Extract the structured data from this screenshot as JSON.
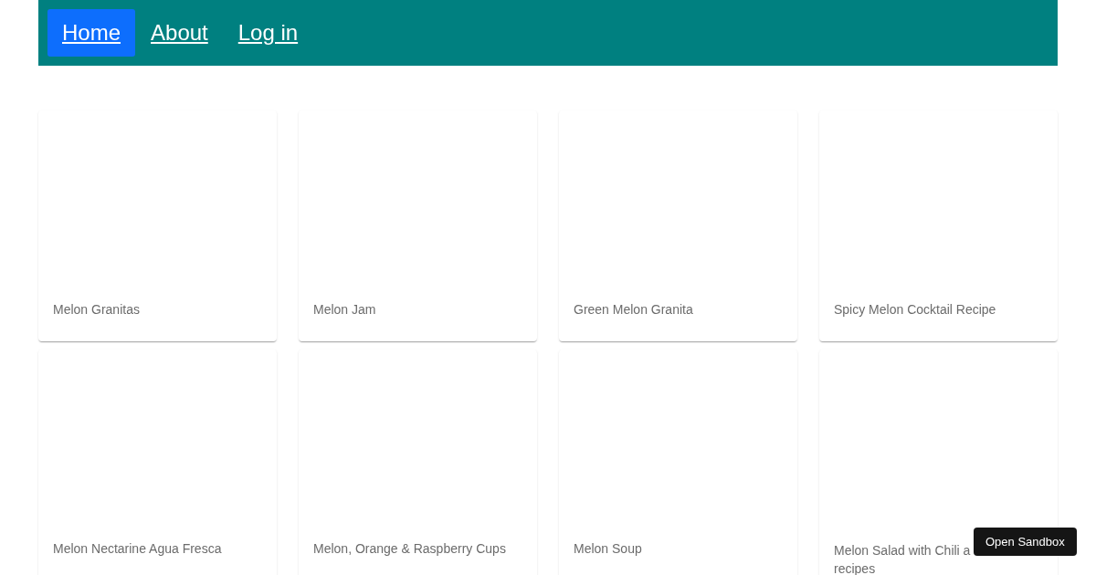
{
  "nav": {
    "links": [
      {
        "label": "Home",
        "selected": true
      },
      {
        "label": "About",
        "selected": false
      },
      {
        "label": "Log in",
        "selected": false
      }
    ]
  },
  "cards": [
    {
      "title": "Melon Granitas"
    },
    {
      "title": "Melon Jam"
    },
    {
      "title": "Green Melon Granita"
    },
    {
      "title": "Spicy Melon Cocktail Recipe"
    },
    {
      "title": "Melon Nectarine Agua Fresca"
    },
    {
      "title": "Melon, Orange & Raspberry Cups"
    },
    {
      "title": "Melon Soup"
    },
    {
      "title": "Melon Salad with Chili a",
      "title_continued": "recipes"
    }
  ],
  "sandbox_button": "Open Sandbox"
}
